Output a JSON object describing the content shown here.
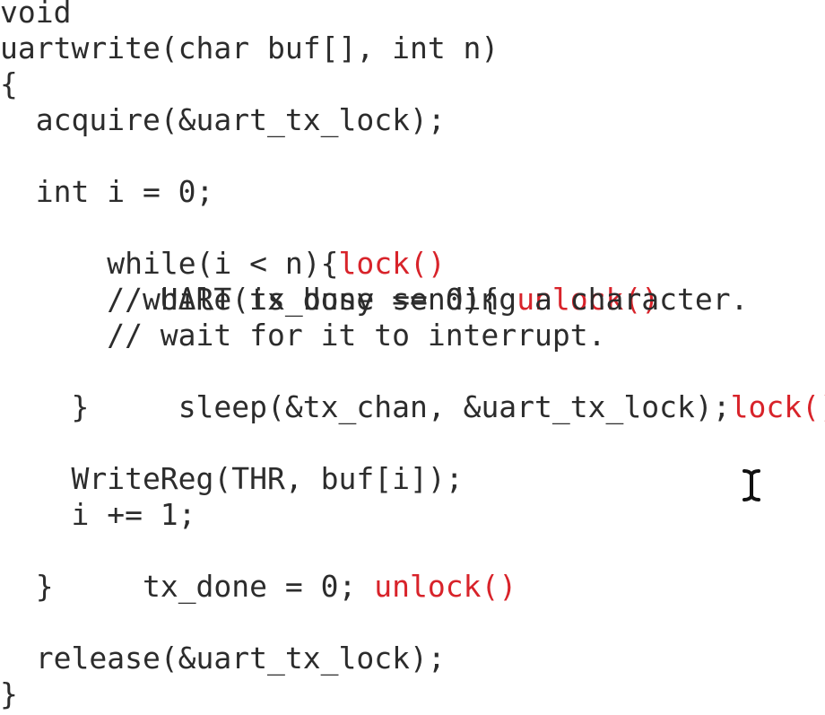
{
  "code": {
    "lines": [
      "void",
      "uartwrite(char buf[], int n)",
      "{",
      "  acquire(&uart_tx_lock);",
      "",
      "  int i = 0;",
      "  while(i < n){",
      "    while(tx_done == 0){",
      "      // UART is busy sending a character.",
      "      // wait for it to interrupt.",
      "      sleep(&tx_chan, &uart_tx_lock);",
      "    }",
      "",
      "    WriteReg(THR, buf[i]);",
      "    i += 1;",
      "    tx_done = 0;",
      "  }",
      "",
      "  release(&uart_tx_lock);",
      "}"
    ]
  },
  "annotations": {
    "while_outer": "lock()",
    "while_inner": "unlock()",
    "sleep": "lock()",
    "tx_done": "unlock()"
  },
  "colors": {
    "code_text": "#2c2c2c",
    "annotation": "#d8232a",
    "background": "#ffffff"
  },
  "cursor_icon": "text-cursor-icon"
}
